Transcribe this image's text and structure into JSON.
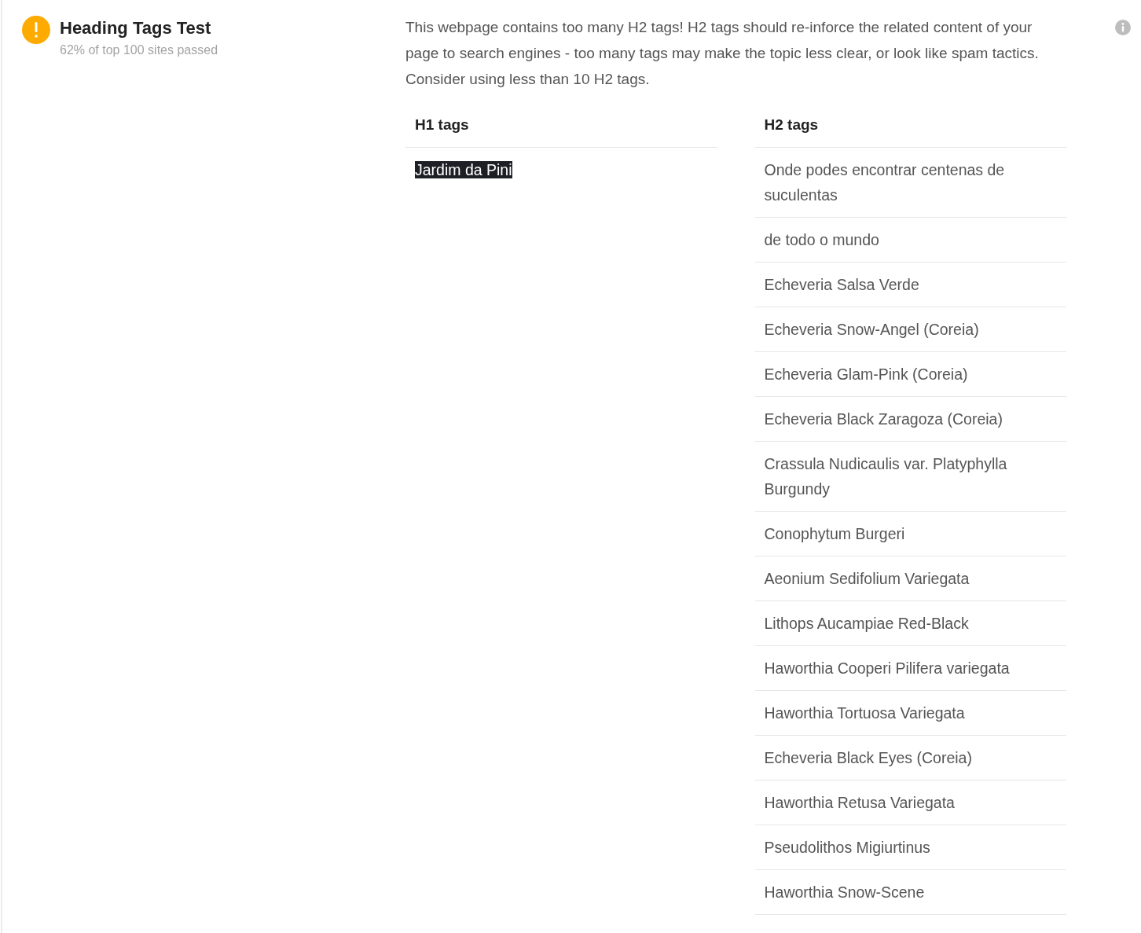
{
  "test": {
    "title": "Heading Tags Test",
    "subtitle": "62% of top 100 sites passed"
  },
  "description": "This webpage contains too many H2 tags! H2 tags should re-inforce the related content of your page to search engines - too many tags may make the topic less clear, or look like spam tactics. Consider using less than 10 H2 tags.",
  "columns": [
    {
      "heading": "H1 tags",
      "items": [
        {
          "text": "Jardim da Pini",
          "highlighted": true
        }
      ]
    },
    {
      "heading": "H2 tags",
      "items": [
        {
          "text": "Onde podes encontrar centenas de suculentas",
          "highlighted": false
        },
        {
          "text": "de todo o mundo",
          "highlighted": false
        },
        {
          "text": "Echeveria Salsa Verde",
          "highlighted": false
        },
        {
          "text": "Echeveria Snow-Angel (Coreia)",
          "highlighted": false
        },
        {
          "text": "Echeveria Glam-Pink (Coreia)",
          "highlighted": false
        },
        {
          "text": "Echeveria Black Zaragoza (Coreia)",
          "highlighted": false
        },
        {
          "text": "Crassula Nudicaulis var. Platyphylla Burgundy",
          "highlighted": false
        },
        {
          "text": "Conophytum Burgeri",
          "highlighted": false
        },
        {
          "text": "Aeonium Sedifolium Variegata",
          "highlighted": false
        },
        {
          "text": "Lithops Aucampiae Red-Black",
          "highlighted": false
        },
        {
          "text": "Haworthia Cooperi Pilifera variegata",
          "highlighted": false
        },
        {
          "text": "Haworthia Tortuosa Variegata",
          "highlighted": false
        },
        {
          "text": "Echeveria Black Eyes (Coreia)",
          "highlighted": false
        },
        {
          "text": "Haworthia Retusa Variegata",
          "highlighted": false
        },
        {
          "text": "Pseudolithos Migiurtinus",
          "highlighted": false
        },
        {
          "text": "Haworthia Snow-Scene",
          "highlighted": false
        }
      ]
    }
  ]
}
